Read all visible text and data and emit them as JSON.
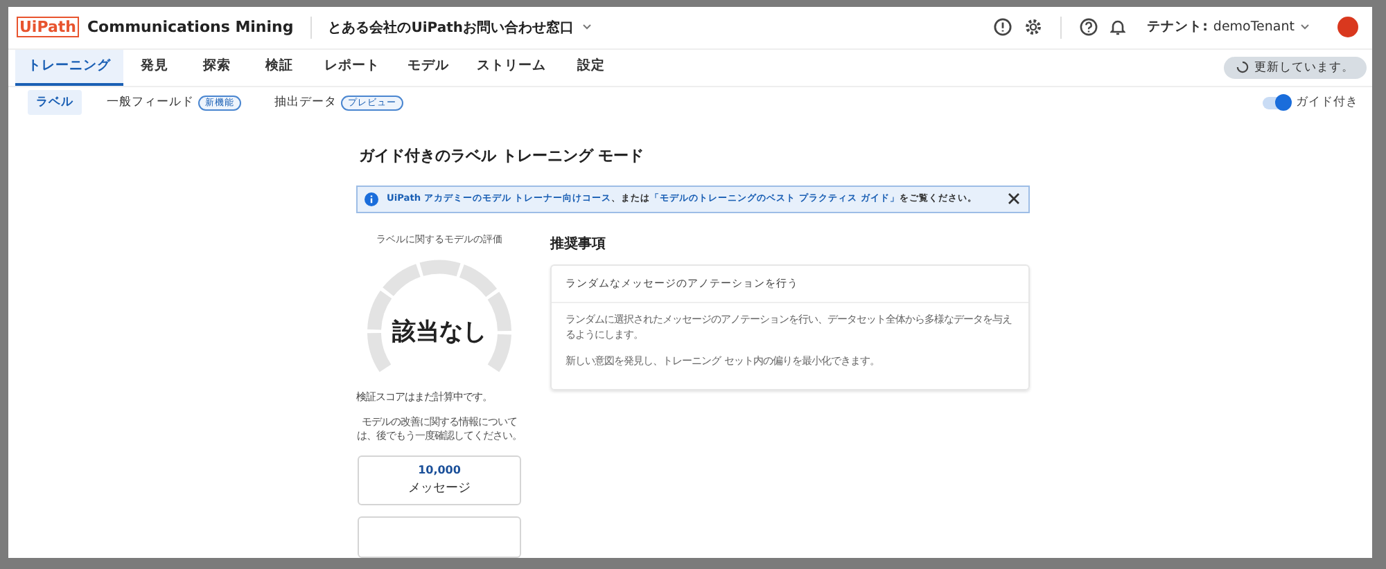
{
  "header": {
    "logo": "UiPath",
    "product": "Communications Mining",
    "dataset": "とある会社のUiPathお問い合わせ窓口",
    "tenant_label": "テナント:",
    "tenant": "demoTenant"
  },
  "tabs": [
    {
      "label": "トレーニング",
      "selected": true
    },
    {
      "label": "発見",
      "selected": false
    },
    {
      "label": "探索",
      "selected": false
    },
    {
      "label": "検証",
      "selected": false
    },
    {
      "label": "レポート",
      "selected": false
    },
    {
      "label": "モデル",
      "selected": false
    },
    {
      "label": "ストリーム",
      "selected": false
    },
    {
      "label": "設定",
      "selected": false
    }
  ],
  "status": {
    "label": "更新しています。"
  },
  "subtabs": [
    {
      "label": "ラベル",
      "selected": true
    },
    {
      "label": "一般フィールド",
      "selected": false,
      "badge": "新機能"
    },
    {
      "label": "抽出データ",
      "selected": false,
      "badge": "プレビュー"
    }
  ],
  "guided_toggle": {
    "label": "ガイド付き",
    "on": true
  },
  "title": "ガイド付きのラベル トレーニング モード",
  "banner": {
    "link_1": "UiPath アカデミーのモデル トレーナー向けコース",
    "text_1": "、または",
    "link_2": "「モデルのトレーニングのベスト プラクティス ガイド」",
    "text_2": "をご覧ください。"
  },
  "rating": {
    "caption": "ラベルに関するモデルの評価",
    "value": "該当なし",
    "status": "検証スコアはまだ計算中です。",
    "note": "モデルの改善に関する情報については、後でもう一度確認してください。"
  },
  "stats": [
    {
      "value": "10,000",
      "label": "メッセージ"
    }
  ],
  "recommendations": {
    "heading": "推奨事項",
    "items": [
      {
        "title": "ランダムなメッセージのアノテーションを行う",
        "paragraphs": [
          "ランダムに選択されたメッセージのアノテーションを行い、データセット全体から多様なデータを与えるようにします。",
          "新しい意図を発見し、トレーニング セット内の偏りを最小化できます。"
        ]
      }
    ]
  }
}
